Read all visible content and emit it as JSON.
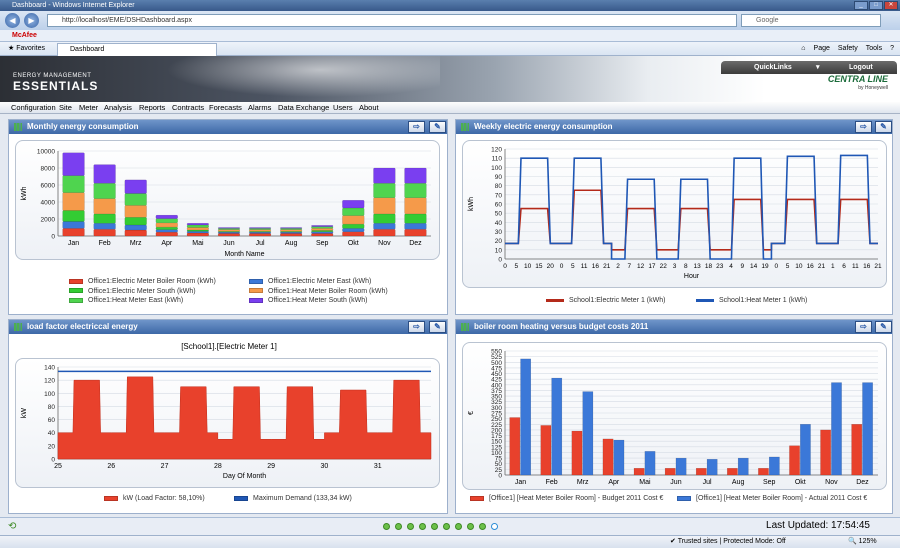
{
  "browser": {
    "title": "Dashboard - Windows Internet Explorer",
    "url": "http://localhost/EME/DSHDashboard.aspx",
    "search_placeholder": "Google",
    "toolbar_item": "McAfee",
    "favorites": "Favorites",
    "tab": "Dashboard",
    "commands": [
      "Page",
      "Safety",
      "Tools"
    ],
    "zone": "Trusted sites | Protected Mode: Off",
    "zoom": "125%"
  },
  "app": {
    "logo_line1": "ENERGY MANAGEMENT",
    "logo_line2": "ESSENTIALS",
    "quicklinks": "QuickLinks",
    "logout": "Logout",
    "brand": "CENTRA LINE",
    "brand_sub": "by Honeywell",
    "menu": [
      "Configuration",
      "Site",
      "Meter",
      "Analysis",
      "Reports",
      "Contracts",
      "Forecasts",
      "Alarms",
      "Data Exchange",
      "Users",
      "About"
    ]
  },
  "panels": {
    "p1": "Monthly energy consumption",
    "p2": "Weekly electric energy consumption",
    "p3": "load factor electriccal energy",
    "p4": "boiler room heating versus budget costs 2011"
  },
  "status": {
    "last_updated": "Last Updated:  17:54:45",
    "pages": 10,
    "current_page": 10
  },
  "chart_data": [
    {
      "type": "bar",
      "stacked": true,
      "title": "",
      "xlabel": "Month Name",
      "ylabel": "kWh",
      "ylim": [
        0,
        10000
      ],
      "yticks": [
        0,
        2000,
        4000,
        6000,
        8000,
        10000
      ],
      "categories": [
        "Jan",
        "Feb",
        "Mrz",
        "Apr",
        "Mai",
        "Jun",
        "Jul",
        "Aug",
        "Sep",
        "Okt",
        "Nov",
        "Dez"
      ],
      "series": [
        {
          "name": "Office1:Electric Meter Boiler Room (kWh)",
          "color": "#e8412c",
          "values": [
            900,
            800,
            700,
            450,
            350,
            300,
            300,
            300,
            300,
            500,
            800,
            800
          ]
        },
        {
          "name": "Office1:Electric Meter East (kWh)",
          "color": "#3b78d8",
          "values": [
            800,
            700,
            600,
            300,
            200,
            150,
            150,
            150,
            200,
            400,
            700,
            700
          ]
        },
        {
          "name": "Office1:Electric Meter South (kWh)",
          "color": "#33cc33",
          "values": [
            1300,
            1100,
            900,
            300,
            150,
            100,
            100,
            100,
            150,
            500,
            1100,
            1100
          ]
        },
        {
          "name": "Office1:Heat Meter Boiler Room (kWh)",
          "color": "#f59a4a",
          "values": [
            2100,
            1800,
            1400,
            500,
            300,
            200,
            200,
            200,
            250,
            1000,
            1900,
            1900
          ]
        },
        {
          "name": "Office1:Heat Meter East (kWh)",
          "color": "#4fd44f",
          "values": [
            2000,
            1800,
            1400,
            500,
            300,
            150,
            150,
            150,
            200,
            900,
            1700,
            1700
          ]
        },
        {
          "name": "Office1:Heat Meter South (kWh)",
          "color": "#7a3ff0",
          "values": [
            2700,
            2200,
            1600,
            400,
            200,
            100,
            100,
            100,
            150,
            900,
            1800,
            1800
          ]
        }
      ]
    },
    {
      "type": "line",
      "title": "",
      "xlabel": "Hour",
      "ylabel": "kWh",
      "ylim": [
        0,
        120
      ],
      "yticks": [
        0,
        10,
        20,
        30,
        40,
        50,
        60,
        70,
        80,
        90,
        100,
        110,
        120
      ],
      "xticks": [
        "0",
        "5",
        "10",
        "15",
        "20",
        "0",
        "5",
        "11",
        "16",
        "21",
        "2",
        "7",
        "12",
        "17",
        "22",
        "3",
        "8",
        "13",
        "18",
        "23",
        "4",
        "9",
        "14",
        "19",
        "0",
        "5",
        "10",
        "16",
        "21",
        "1",
        "6",
        "11",
        "16",
        "21"
      ],
      "series": [
        {
          "name": "School1:Electric Meter 1 (kWh)",
          "color": "#b42a1a",
          "days": [
            {
              "base": 17,
              "level": 55
            },
            {
              "base": 17,
              "level": 75
            },
            {
              "base": 10,
              "level": 55
            },
            {
              "base": 10,
              "level": 55
            },
            {
              "base": 10,
              "level": 65
            },
            {
              "base": 17,
              "level": 65
            },
            {
              "base": 17,
              "level": 65
            }
          ]
        },
        {
          "name": "School1:Heat Meter 1 (kWh)",
          "color": "#1f57b5",
          "days": [
            {
              "base": 17,
              "level": 110
            },
            {
              "base": 17,
              "level": 110
            },
            {
              "base": 0,
              "level": 87
            },
            {
              "base": 0,
              "level": 87
            },
            {
              "base": 0,
              "level": 110
            },
            {
              "base": 17,
              "level": 112
            },
            {
              "base": 17,
              "level": 113
            }
          ]
        }
      ]
    },
    {
      "type": "area",
      "title": "[School1].[Electric Meter 1]",
      "xlabel": "Day Of Month",
      "ylabel": "kW",
      "ylim": [
        0,
        140
      ],
      "yticks": [
        0,
        20,
        40,
        60,
        80,
        100,
        120,
        140
      ],
      "xticks": [
        "25",
        "26",
        "27",
        "28",
        "29",
        "30",
        "31"
      ],
      "xlim": [
        25,
        32
      ],
      "series": [
        {
          "name": "kW (Load Factor: 58,10%)",
          "color": "#e8412c",
          "days": [
            {
              "base": 40,
              "level": 120
            },
            {
              "base": 40,
              "level": 125
            },
            {
              "base": 40,
              "level": 110
            },
            {
              "base": 30,
              "level": 110
            },
            {
              "base": 30,
              "level": 110
            },
            {
              "base": 40,
              "level": 105
            },
            {
              "base": 40,
              "level": 120
            }
          ]
        },
        {
          "name": "Maximum Demand (133,34 kW)",
          "color": "#1f57b5",
          "value": 133.34
        }
      ]
    },
    {
      "type": "bar",
      "title": "",
      "xlabel": "",
      "ylabel": "€",
      "ylim": [
        0,
        550
      ],
      "yticks": [
        0,
        25,
        50,
        75,
        100,
        125,
        150,
        175,
        200,
        225,
        250,
        275,
        300,
        325,
        350,
        375,
        400,
        425,
        450,
        475,
        500,
        525,
        550
      ],
      "categories": [
        "Jan",
        "Feb",
        "Mrz",
        "Apr",
        "Mai",
        "Jun",
        "Jul",
        "Aug",
        "Sep",
        "Okt",
        "Nov",
        "Dez"
      ],
      "series": [
        {
          "name": "[Office1] [Heat Meter Boiler Room] - Budget 2011 Cost €",
          "color": "#e8412c",
          "values": [
            255,
            220,
            195,
            160,
            30,
            30,
            30,
            30,
            30,
            130,
            200,
            225
          ]
        },
        {
          "name": "[Office1] [Heat Meter Boiler Room] - Actual 2011 Cost €",
          "color": "#3b78d8",
          "values": [
            515,
            430,
            370,
            155,
            105,
            75,
            70,
            75,
            80,
            225,
            410,
            410
          ]
        }
      ]
    }
  ]
}
